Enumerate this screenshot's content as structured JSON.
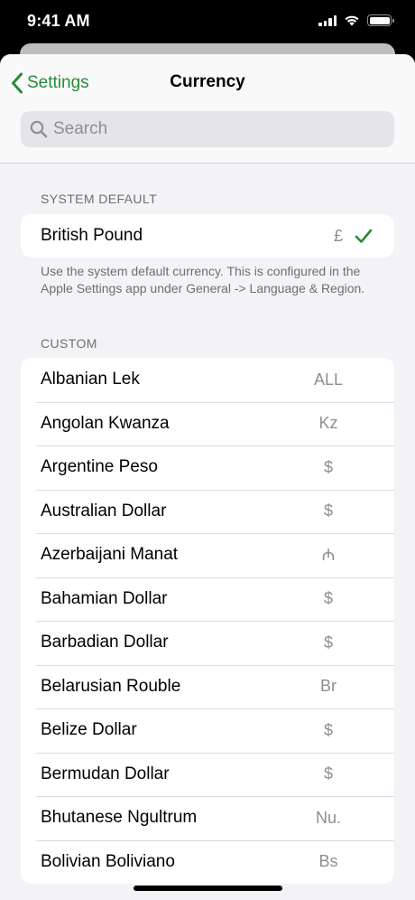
{
  "status_bar": {
    "time": "9:41 AM"
  },
  "nav": {
    "back_label": "Settings",
    "title": "Currency"
  },
  "search": {
    "placeholder": "Search",
    "value": ""
  },
  "system_default": {
    "header": "SYSTEM DEFAULT",
    "item": {
      "name": "British Pound",
      "symbol": "£",
      "selected": true
    },
    "footer": "Use the system default currency. This is configured in the Apple Settings app under General -> Language & Region."
  },
  "custom": {
    "header": "CUSTOM",
    "items": [
      {
        "name": "Albanian Lek",
        "symbol": "ALL"
      },
      {
        "name": "Angolan Kwanza",
        "symbol": "Kz"
      },
      {
        "name": "Argentine Peso",
        "symbol": "$"
      },
      {
        "name": "Australian Dollar",
        "symbol": "$"
      },
      {
        "name": "Azerbaijani Manat",
        "symbol": "₼"
      },
      {
        "name": "Bahamian Dollar",
        "symbol": "$"
      },
      {
        "name": "Barbadian Dollar",
        "symbol": "$"
      },
      {
        "name": "Belarusian Rouble",
        "symbol": "Br"
      },
      {
        "name": "Belize Dollar",
        "symbol": "$"
      },
      {
        "name": "Bermudan Dollar",
        "symbol": "$"
      },
      {
        "name": "Bhutanese Ngultrum",
        "symbol": "Nu."
      },
      {
        "name": "Bolivian Boliviano",
        "symbol": "Bs"
      }
    ]
  },
  "colors": {
    "accent": "#2a8a3a",
    "background": "#f2f2f7",
    "secondary_text": "#8e8e93"
  }
}
